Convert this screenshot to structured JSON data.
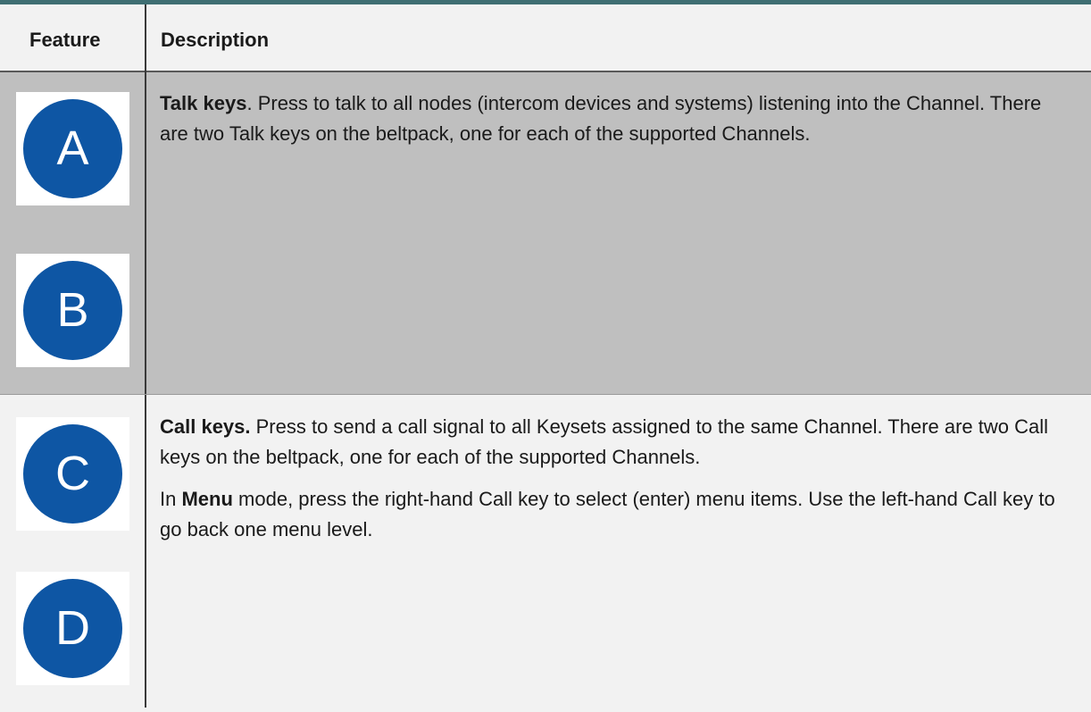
{
  "table": {
    "header": {
      "feature": "Feature",
      "description": "Description"
    },
    "rows": [
      {
        "keys": [
          {
            "letter": "A",
            "icon": "talk-key-a-icon"
          },
          {
            "letter": "B",
            "icon": "talk-key-b-icon"
          }
        ],
        "title": "Talk keys",
        "title_suffix": ".",
        "text": " Press to talk to all nodes (intercom devices and systems) listening into the Channel. There are two Talk keys on the beltpack, one for each of the supported Channels."
      },
      {
        "keys": [
          {
            "letter": "C",
            "icon": "call-key-c-icon"
          },
          {
            "letter": "D",
            "icon": "call-key-d-icon"
          }
        ],
        "title": "Call keys.",
        "text": " Press to send a call signal to all Keysets assigned to the same Channel. There are two Call keys on the beltpack, one for each of the supported Channels.",
        "para2_prefix": "In ",
        "para2_bold": "Menu",
        "para2_text": " mode, press the right-hand Call key to select (enter) menu items. Use the left-hand Call key to go back one menu level."
      }
    ]
  },
  "colors": {
    "key_blue": "#0e56a4",
    "header_bg": "#f2f2f2",
    "row1_bg": "#bfbfbf",
    "row2_bg": "#f2f2f2",
    "top_rule": "#3f6f73"
  }
}
